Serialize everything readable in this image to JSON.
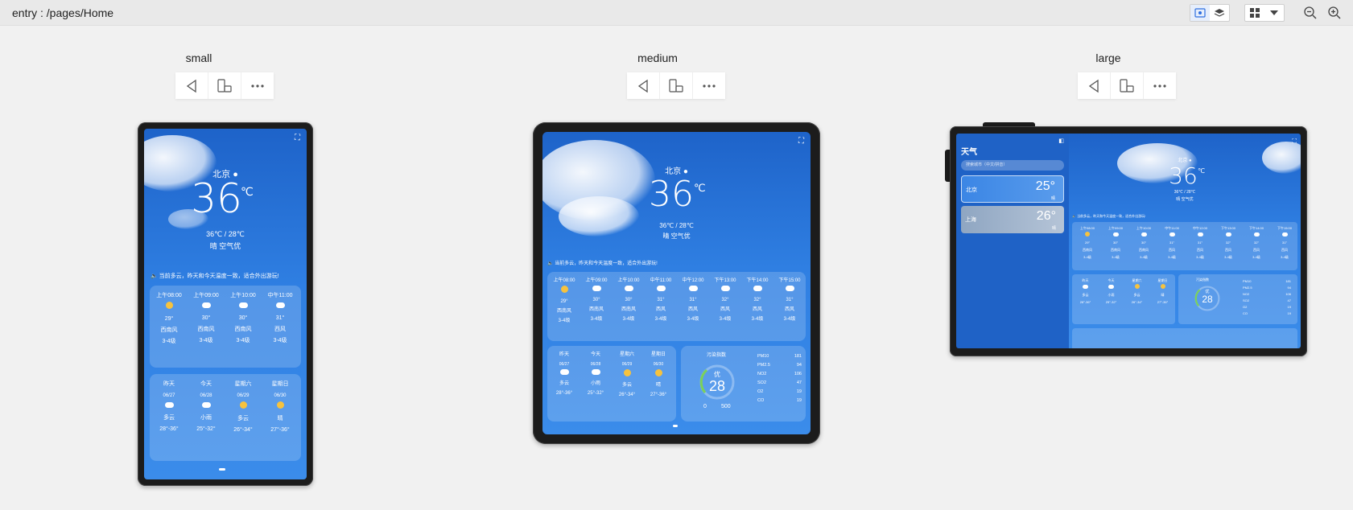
{
  "header": {
    "entry": "entry : /pages/Home"
  },
  "devices": {
    "small": {
      "title": "small"
    },
    "medium": {
      "title": "medium"
    },
    "large": {
      "title": "large"
    }
  },
  "weather": {
    "city": "北京",
    "temp": "36",
    "unit": "℃",
    "range": "36℃ / 28℃",
    "desc": "晴 空气优",
    "tip": "当前多云，昨天和今天温度一致，适合外出游玩!",
    "hourly": [
      {
        "time": "上午08:00",
        "temp": "29°",
        "wind": "西南风",
        "level": "3-4级"
      },
      {
        "time": "上午09:00",
        "temp": "30°",
        "wind": "西南风",
        "level": "3-4级"
      },
      {
        "time": "上午10:00",
        "temp": "30°",
        "wind": "西南风",
        "level": "3-4级"
      },
      {
        "time": "中午11:00",
        "temp": "31°",
        "wind": "西风",
        "level": "3-4级"
      },
      {
        "time": "中午12:00",
        "temp": "31°",
        "wind": "西风",
        "level": "3-4级"
      },
      {
        "time": "下午13:00",
        "temp": "32°",
        "wind": "西风",
        "level": "3-4级"
      },
      {
        "time": "下午14:00",
        "temp": "32°",
        "wind": "西风",
        "level": "3-4级"
      },
      {
        "time": "下午15:00",
        "temp": "31°",
        "wind": "西风",
        "level": "3-4级"
      }
    ],
    "daily": [
      {
        "day": "昨天",
        "date": "06/27",
        "cond": "多云",
        "range": "28°-36°"
      },
      {
        "day": "今天",
        "date": "06/28",
        "cond": "小雨",
        "range": "25°-32°"
      },
      {
        "day": "星期六",
        "date": "06/29",
        "cond": "多云",
        "range": "26°-34°"
      },
      {
        "day": "星期日",
        "date": "06/30",
        "cond": "晴",
        "range": "27°-36°"
      }
    ],
    "aqi": {
      "title": "污染指数",
      "level": "优",
      "value": "28",
      "min": "0",
      "max": "500",
      "items": [
        {
          "name": "PM10",
          "value": "181"
        },
        {
          "name": "PM2.5",
          "value": "94"
        },
        {
          "name": "NO2",
          "value": "106"
        },
        {
          "name": "SO2",
          "value": "47"
        },
        {
          "name": "O2",
          "value": "19"
        },
        {
          "name": "CO",
          "value": "19"
        }
      ]
    }
  },
  "large_sidebar": {
    "title": "天气",
    "search_placeholder": "搜索城市（中文/拼音）",
    "cities": [
      {
        "name": "北京",
        "temp": "25°",
        "cond": "晴"
      },
      {
        "name": "上海",
        "temp": "26°",
        "cond": "晴"
      }
    ]
  },
  "colors": {
    "sky_top": "#1e63c9",
    "sky_bottom": "#3b8cea",
    "sun": "#f6c23e",
    "aqi_ring": "#7bd15a"
  },
  "icons": [
    "eye-icon",
    "layers-icon",
    "grid-icon",
    "chevron-down-icon",
    "zoom-out-icon",
    "zoom-in-icon",
    "back-icon",
    "device-rotate-icon",
    "more-icon",
    "fullscreen-icon",
    "location-icon",
    "speaker-icon",
    "sun-cloud-icon",
    "rain-icon"
  ]
}
